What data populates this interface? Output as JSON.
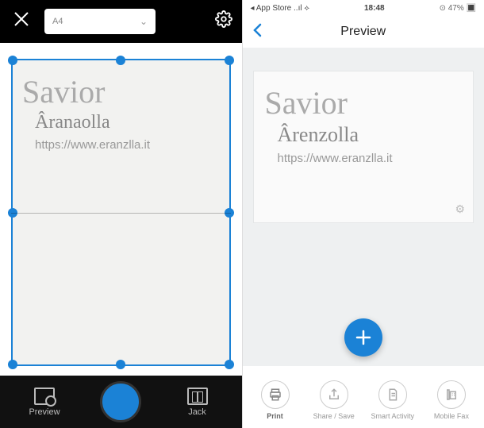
{
  "left": {
    "paper_size": "A4",
    "document": {
      "title": "Savior",
      "subtitle": "Âranaolla",
      "url": "https://www.eranzlla.it"
    },
    "bottom": {
      "preview_label": "Preview",
      "jack_label": "Jack"
    }
  },
  "right": {
    "status": {
      "back_source": "App Store",
      "time": "18:48",
      "battery": "47%"
    },
    "header": {
      "title": "Preview"
    },
    "document": {
      "title": "Savior",
      "subtitle": "Ârenzolla",
      "url": "https://www.eranzlla.it"
    },
    "actions": {
      "print": "Print",
      "share": "Share / Save",
      "smart": "Smart Activity",
      "fax": "Mobile Fax"
    }
  }
}
